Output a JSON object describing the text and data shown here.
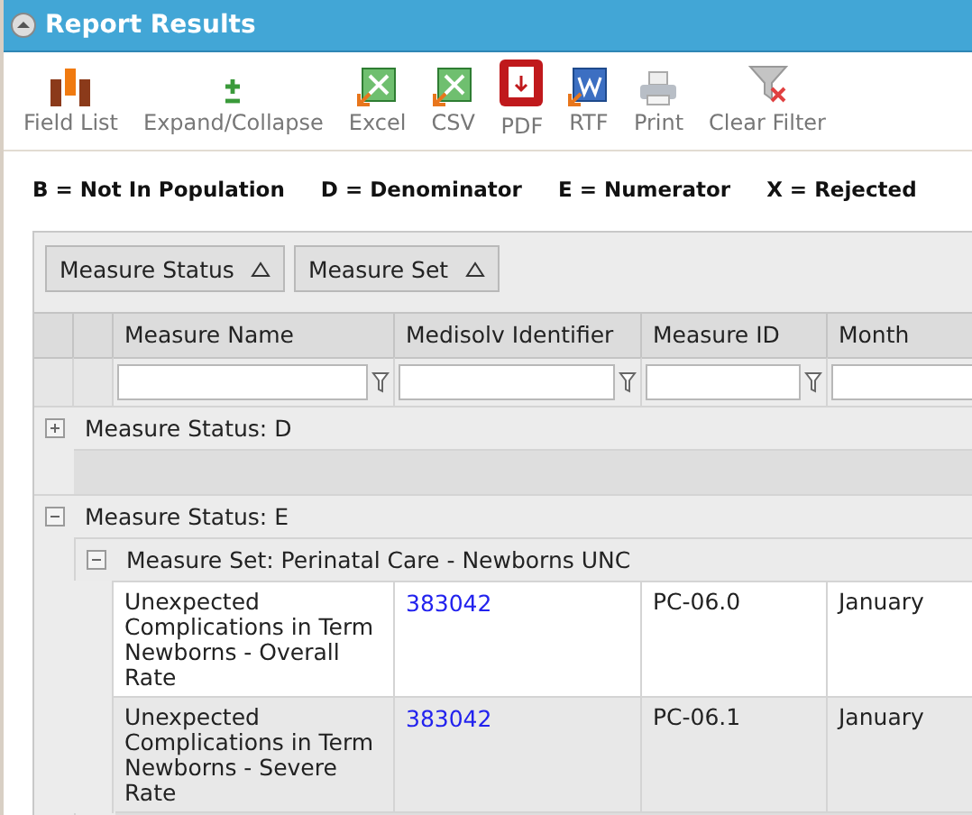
{
  "window": {
    "title": "Report Results"
  },
  "toolbar": [
    {
      "kind": "field-list",
      "label": "Field List"
    },
    {
      "kind": "expand",
      "label": "Expand/Collapse"
    },
    {
      "kind": "excel",
      "label": "Excel"
    },
    {
      "kind": "csv",
      "label": "CSV"
    },
    {
      "kind": "pdf",
      "label": "PDF"
    },
    {
      "kind": "rtf",
      "label": "RTF"
    },
    {
      "kind": "print",
      "label": "Print"
    },
    {
      "kind": "clear-filter",
      "label": "Clear Filter"
    }
  ],
  "legend": [
    "B = Not In Population",
    "D = Denominator",
    "E = Numerator",
    "X = Rejected"
  ],
  "group_panel": [
    "Measure Status",
    "Measure Set"
  ],
  "table": {
    "columns": [
      "Measure Name",
      "Medisolv Identifier",
      "Measure ID",
      "Month"
    ],
    "groups": [
      {
        "label": "Measure Status: D",
        "expanded": false
      },
      {
        "label": "Measure Status: E",
        "expanded": true,
        "children": [
          {
            "label": "Measure Set: Perinatal Care - Newborns UNC",
            "expanded": true,
            "rows": [
              [
                "Unexpected Complications in Term Newborns - Overall Rate",
                "383042",
                "PC-06.0",
                "January"
              ],
              [
                "Unexpected Complications in Term Newborns - Severe Rate",
                "383042",
                "PC-06.1",
                "January"
              ]
            ]
          }
        ]
      }
    ]
  }
}
